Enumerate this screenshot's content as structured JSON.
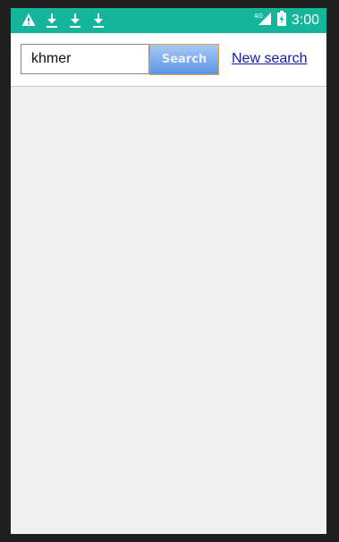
{
  "status_bar": {
    "left_icons": [
      "warning-icon",
      "download-icon",
      "download-icon",
      "download-icon"
    ],
    "network_label": "4G",
    "time": "3:00",
    "background_color": "#14b59b"
  },
  "toolbar": {
    "search_value": "khmer",
    "search_button_label": "Search",
    "new_search_label": "New search",
    "link_color": "#1a1aa6"
  }
}
